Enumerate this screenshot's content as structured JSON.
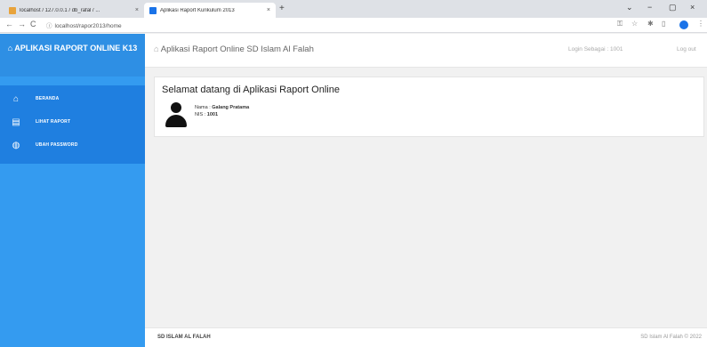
{
  "browser": {
    "tabs": [
      {
        "title": "localhost / 127.0.0.1 / db_rafal / ...",
        "close": "×",
        "icon": "phpmyadmin-icon"
      },
      {
        "title": "Aplikasi Raport Kurikulum 2013",
        "close": "×",
        "icon": "app-icon"
      }
    ],
    "new_tab": "+",
    "url": "localhost/rapor2013/home",
    "controls": {
      "back": "←",
      "forward": "→",
      "reload": "C",
      "min": "−",
      "max": "▢",
      "close": "×",
      "menu": "⋮"
    }
  },
  "sidebar": {
    "brand_icon": "graduation-cap-icon",
    "brand": "APLIKASI RAPORT ONLINE K13",
    "brand_prefix": "⌂",
    "items": [
      {
        "label": "BERANDA",
        "icon": "home-icon",
        "glyph": "⌂"
      },
      {
        "label": "LIHAT RAPORT",
        "icon": "report-icon",
        "glyph": "▤"
      },
      {
        "label": "UBAH PASSWORD",
        "icon": "password-icon",
        "glyph": "◍"
      }
    ]
  },
  "header": {
    "title": "Aplikasi Raport Online SD Islam Al Falah",
    "login_as": "Login Sebagai : 1001",
    "logout": "Log out"
  },
  "welcome": {
    "heading": "Selamat datang di Aplikasi Raport Online",
    "name_label": "Nama : ",
    "name_value": "Galang Pratama",
    "nis_label": "NIS : ",
    "nis_value": "1001"
  },
  "footer": {
    "left": "SD ISLAM AL FALAH",
    "right": "SD Islam Al Falah © 2022"
  },
  "colors": {
    "sidebar": "#349bf0",
    "menu": "#1f7fe0",
    "brand": "#2e8fe4"
  }
}
